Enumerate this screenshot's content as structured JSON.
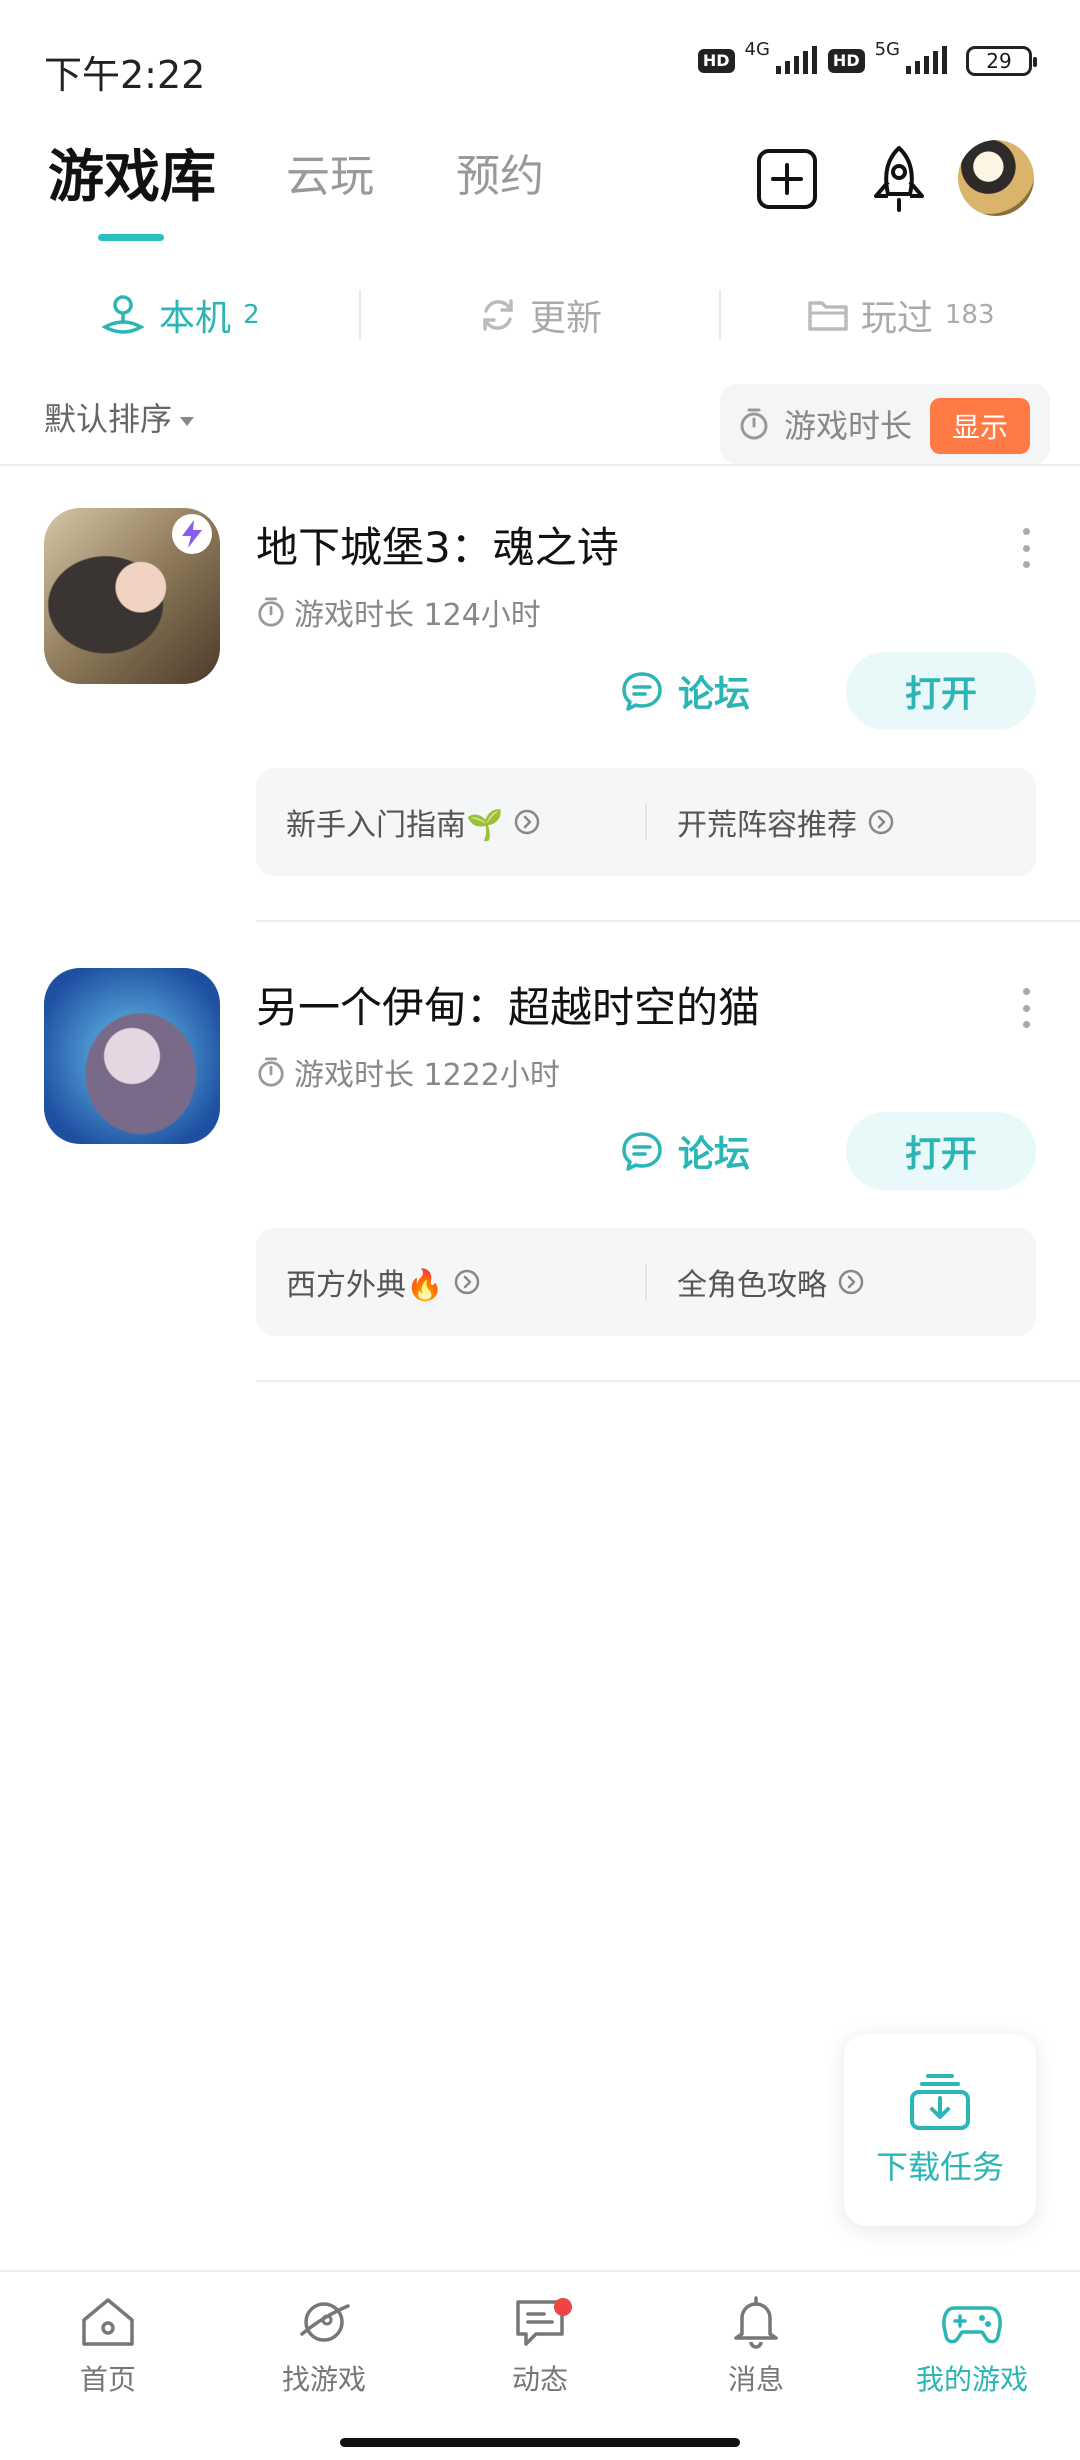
{
  "status_bar": {
    "time": "下午2:22",
    "net1": "4G",
    "net2": "5G",
    "hd": "HD",
    "battery": "29"
  },
  "top_tabs": [
    {
      "label": "游戏库",
      "active": true
    },
    {
      "label": "云玩",
      "active": false
    },
    {
      "label": "预约",
      "active": false
    }
  ],
  "sub_tabs": {
    "local": {
      "label": "本机",
      "count": "2"
    },
    "update": {
      "label": "更新"
    },
    "played": {
      "label": "玩过",
      "count": "183"
    }
  },
  "sort": {
    "label": "默认排序",
    "playtime_label": "游戏时长",
    "show_label": "显示"
  },
  "games": [
    {
      "title": "地下城堡3：魂之诗",
      "playtime": "游戏时长 124小时",
      "forum": "论坛",
      "open": "打开",
      "guides": [
        "新手入门指南🌱",
        "开荒阵容推荐"
      ]
    },
    {
      "title": "另一个伊甸：超越时空的猫",
      "playtime": "游戏时长 1222小时",
      "forum": "论坛",
      "open": "打开",
      "guides": [
        "西方外典🔥",
        "全角色攻略"
      ]
    }
  ],
  "download": {
    "label": "下载任务"
  },
  "bottom_nav": [
    {
      "label": "首页",
      "icon": "home-icon"
    },
    {
      "label": "找游戏",
      "icon": "planet-icon"
    },
    {
      "label": "动态",
      "icon": "chat-icon"
    },
    {
      "label": "消息",
      "icon": "bell-icon"
    },
    {
      "label": "我的游戏",
      "icon": "gamepad-icon"
    }
  ],
  "colors": {
    "accent": "#2bb5b5",
    "orange": "#ff7a45",
    "badge_red": "#ee4444"
  }
}
